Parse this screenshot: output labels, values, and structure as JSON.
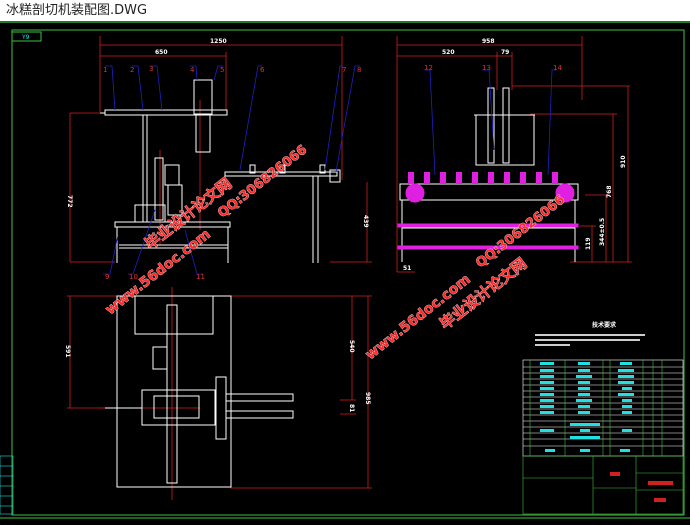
{
  "window": {
    "title": "冰糕剖切机装配图.DWG"
  },
  "drawing": {
    "tag": "Y9",
    "front_view": {
      "dims": {
        "overall_width": "1250",
        "arm_width": "650",
        "height": "772",
        "table_height": "439"
      },
      "balloons": [
        "1",
        "2",
        "3",
        "4",
        "5",
        "6",
        "7",
        "8",
        "9",
        "10",
        "11"
      ]
    },
    "side_view": {
      "dims": {
        "overall_width": "958",
        "left_width": "520",
        "offset": "79",
        "height": "910",
        "conveyor_height": "768",
        "tolerance": "344±0.5",
        "lower": "119",
        "foot": "51"
      },
      "balloons": [
        "12",
        "13",
        "14"
      ]
    },
    "top_view": {
      "dims": {
        "left": "591",
        "right": "540",
        "overall": "985",
        "small": "81"
      }
    },
    "tech_requirements": {
      "heading": "技术要求"
    },
    "watermarks": {
      "site_cn": "毕业设计论文网",
      "qq": "QQ:306826066",
      "url": "www.56doc.com"
    }
  },
  "colors": {
    "frame": "#3fbf3f",
    "dimension": "#d02020",
    "leader": "#2020c0",
    "part": "#ffffff",
    "conveyor": "#e020e0",
    "table": "#20e0e0"
  }
}
